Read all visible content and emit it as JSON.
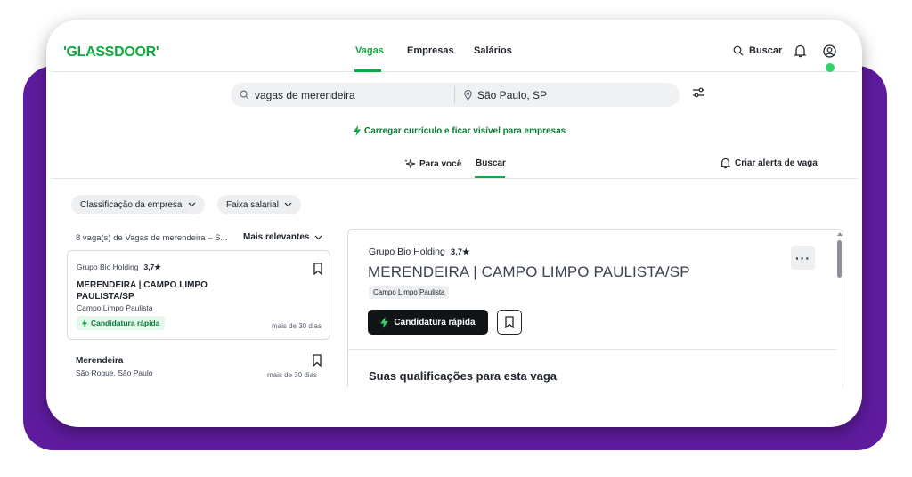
{
  "brand": {
    "logo": "'GLASSDOOR'",
    "green": "#0caa41",
    "frame_purple": "#5f1b9e"
  },
  "header": {
    "tabs": [
      {
        "label": "Vagas",
        "active": true
      },
      {
        "label": "Empresas",
        "active": false
      },
      {
        "label": "Salários",
        "active": false
      }
    ],
    "search_label": "Buscar",
    "icons": [
      "search-icon",
      "bell-icon",
      "user-icon"
    ]
  },
  "search": {
    "keyword": "vagas de merendeira",
    "location": "São Paulo, SP",
    "filter_icon": "sliders-icon"
  },
  "upload_link": "Carregar currículo e ficar visível para empresas",
  "subtabs": [
    {
      "label": "Para você",
      "active": false,
      "icon": "sparkle-icon"
    },
    {
      "label": "Buscar",
      "active": true
    }
  ],
  "create_alert": "Criar alerta de vaga",
  "filters": [
    {
      "label": "Classificação da empresa"
    },
    {
      "label": "Faixa salarial"
    }
  ],
  "results": {
    "count_text": "8 vaga(s) de Vagas de merendeira – S...",
    "sort_label": "Mais relevantes"
  },
  "jobs": [
    {
      "company": "Grupo Bio Holding",
      "rating": "3,7★",
      "title": "MERENDEIRA | CAMPO LIMPO PAULISTA/SP",
      "location": "Campo Limpo Paulista",
      "badge": "Candidatura rápida",
      "age": "mais de 30 dias"
    },
    {
      "title": "Merendeira",
      "location": "São Roque, São Paulo",
      "age": "mais de 30 dias"
    }
  ],
  "detail": {
    "company": "Grupo Bio Holding",
    "rating": "3,7★",
    "title": "MERENDEIRA | CAMPO LIMPO PAULISTA/SP",
    "location": "Campo Limpo Paulista",
    "apply_label": "Candidatura rápida",
    "more_label": "···",
    "qualifications_heading": "Suas qualificações para esta vaga"
  }
}
